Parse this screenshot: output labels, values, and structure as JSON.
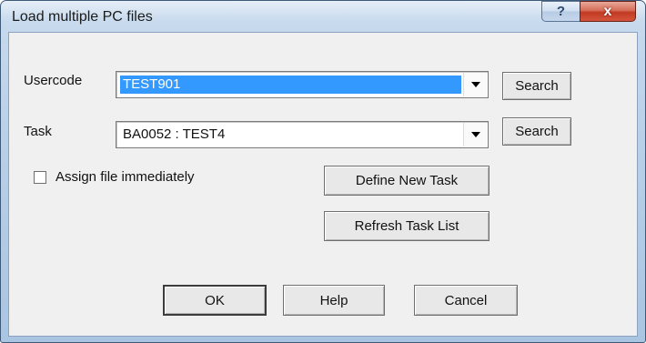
{
  "window": {
    "title": "Load multiple PC files",
    "help_glyph": "?",
    "close_glyph": "x"
  },
  "usercode": {
    "label": "Usercode",
    "value": "TEST901",
    "search_label": "Search"
  },
  "task": {
    "label": "Task",
    "value": "BA0052 : TEST4",
    "search_label": "Search"
  },
  "assign": {
    "label": "Assign file immediately",
    "checked": false
  },
  "buttons": {
    "define_new_task": "Define New Task",
    "refresh_task_list": "Refresh Task List",
    "ok": "OK",
    "help": "Help",
    "cancel": "Cancel"
  },
  "colors": {
    "selection": "#3399ff",
    "close_button": "#c23a22"
  }
}
